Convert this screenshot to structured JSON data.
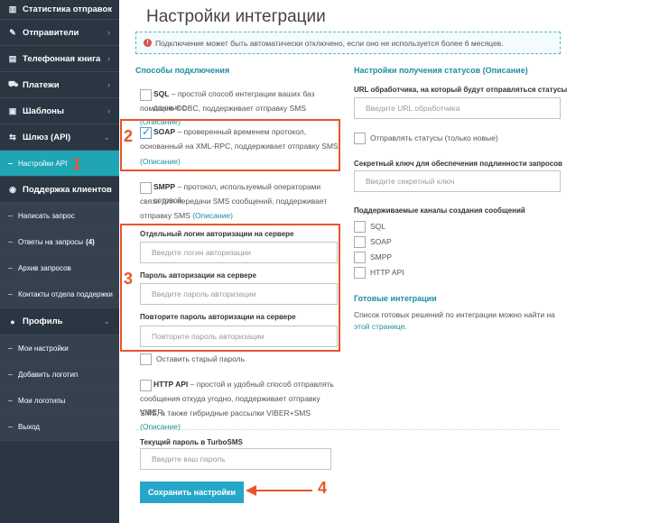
{
  "sidebar": {
    "items": [
      {
        "label": "Статистика отправок",
        "icon": "bar-chart-icon",
        "glyph": "▥"
      },
      {
        "label": "Отправители",
        "icon": "pencil-icon",
        "glyph": "✎"
      },
      {
        "label": "Телефонная книга",
        "icon": "addressbook-icon",
        "glyph": "▤"
      },
      {
        "label": "Платежи",
        "icon": "cart-icon",
        "glyph": "⛟"
      },
      {
        "label": "Шаблоны",
        "icon": "template-icon",
        "glyph": "▣"
      },
      {
        "label": "Шлюз (API)",
        "icon": "gateway-icon",
        "glyph": "⇆"
      },
      {
        "label": "Поддержка клиентов",
        "icon": "support-icon",
        "glyph": "◉"
      },
      {
        "label": "Профиль",
        "icon": "user-icon",
        "glyph": "●"
      }
    ],
    "api_sub": {
      "label": "Настройки API"
    },
    "support_sub": [
      {
        "label": "Написать запрос"
      },
      {
        "label": "Ответы на запросы",
        "count": "(4)"
      },
      {
        "label": "Архив запросов"
      },
      {
        "label": "Контакты отдела поддержки"
      }
    ],
    "profile_sub": [
      {
        "label": "Мои настройки"
      },
      {
        "label": "Добавить логотип"
      },
      {
        "label": "Мои логотипы"
      },
      {
        "label": "Выход"
      }
    ]
  },
  "page": {
    "title": "Настройки интеграции",
    "alert": "Подключение может быть автоматически отключено, если оно не используется более 6 месяцев."
  },
  "left": {
    "section_title": "Способы подключения",
    "sql": {
      "name": "SQL",
      "text1": " – простой способ интеграции ваших баз данных с",
      "text2": "помощью ODBC, поддерживает отправку SMS ",
      "link": "(Описание)",
      "checked": false
    },
    "soap": {
      "name": "SOAP",
      "text1": " – проверенный временем протокол,",
      "text2": "основанный на XML-RPC, поддерживает отправку SMS",
      "link": "(Описание)",
      "checked": true
    },
    "smpp": {
      "name": "SMPP",
      "text1": " – протокол, используемый операторами сотовой",
      "text2": "связи для передачи SMS сообщений, поддерживает",
      "text3": "отправку SMS ",
      "link": "(Описание)",
      "checked": false
    },
    "login_label": "Отдельный логин авторизации на сервере",
    "login_placeholder": "Введите логин авторизации",
    "password_label": "Пароль авторизации на сервере",
    "password_placeholder": "Введите пароль авторизации",
    "repeat_label": "Повторите пароль авторизации на сервере",
    "repeat_placeholder": "Повторите пароль авторизации",
    "keep_old_label": "Оставить старый пароль",
    "http": {
      "name": "HTTP API",
      "text1": " – простой и удобный способ отправлять",
      "text2": "сообщения откуда угодно, поддерживает отправку VIBER,",
      "text3": "SMS, а также гибридные рассылки VIBER+SMS ",
      "link": "(Описание)",
      "checked": false
    },
    "current_pw_label": "Текущий пароль в TurboSMS",
    "current_pw_placeholder": "Введите ваш пароль",
    "save_label": "Сохранить настройки"
  },
  "right": {
    "section_title": "Настройки получения статусов",
    "section_link": "(Описание)",
    "url_label": "URL обработчика, на который будут отправляться статусы",
    "url_placeholder": "Введите URL обработчика",
    "send_statuses_label": "Отправлять статусы (только новые)",
    "secret_label": "Секретный ключ для обеспечения подлинности запросов",
    "secret_placeholder": "Введите секретный ключ",
    "channels_label": "Поддерживаемые каналы создания сообщений",
    "channels": [
      "SQL",
      "SOAP",
      "SMPP",
      "HTTP API"
    ],
    "ready_title": "Готовые интеграции",
    "ready_text1": "Список готовых решений по интеграции можно найти на ",
    "ready_link1": "этой",
    "ready_link2": "странице",
    "ready_end": "."
  },
  "annotations": [
    "1",
    "2",
    "3",
    "4"
  ],
  "colors": {
    "sidebar_bg": "#2b3643",
    "accent": "#1fa5b4",
    "highlight": "#e8552b",
    "button": "#26a7c9"
  }
}
